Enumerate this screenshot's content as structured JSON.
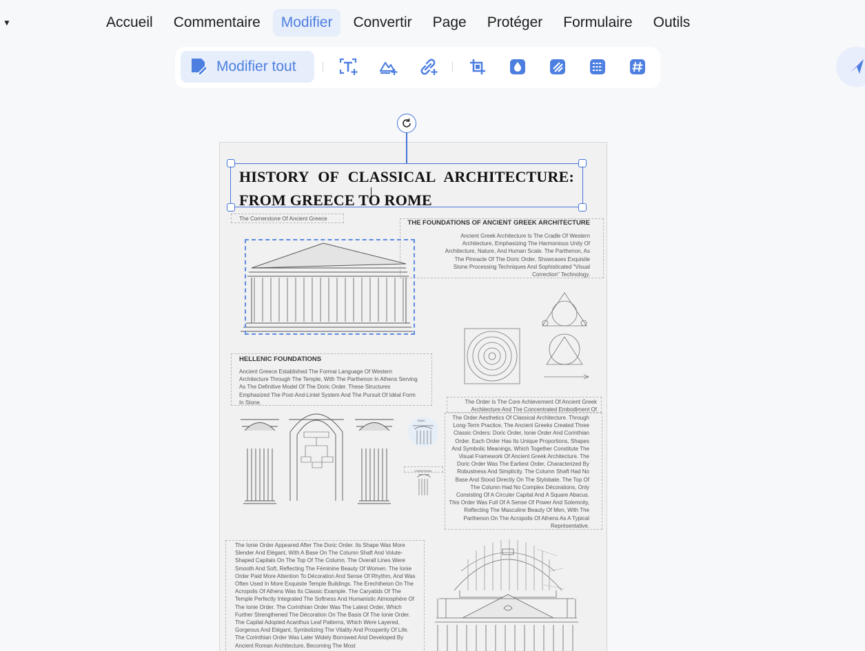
{
  "menu": {
    "items": [
      {
        "label": "Accueil"
      },
      {
        "label": "Commentaire"
      },
      {
        "label": "Modifier"
      },
      {
        "label": "Convertir"
      },
      {
        "label": "Page"
      },
      {
        "label": "Protéger"
      },
      {
        "label": "Formulaire"
      },
      {
        "label": "Outils"
      }
    ],
    "active_index": 2
  },
  "toolbar": {
    "edit_all_label": "Modifier tout",
    "tools": [
      "add-text-icon",
      "add-image-icon",
      "add-link-icon",
      "crop-icon",
      "watermark-icon",
      "background-icon",
      "header-footer-icon",
      "bates-number-icon"
    ]
  },
  "colors": {
    "accent": "#4d7fe0",
    "selection": "#4472d8",
    "active_bg": "#e6edfb"
  },
  "document": {
    "title": "HISTORY OF CLASSICAL ARCHITECTURE: FROM GREECE TO ROME",
    "caption": "The Cornerstone Of Ancient Greece",
    "foundations": {
      "heading": "THE FOUNDATIONS OF ANCIENT GREEK ARCHITECTURE",
      "body": "Ancient Greek Architecture Is The Cradle Of Western Architecture, Emphasizing The Harmonious Unity Of Architecture, Nature, And Human Scale. The Parthenon, As The Pinnacle Of The Doric Order, Showcases Exquisite Stone Processing Techniques And Sophisticated \"Visual Correction\" Technology."
    },
    "hellenic": {
      "heading": "HELLENIC FOUNDATIONS",
      "body": "Ancient Greece Established The Formai Language Of Western Architecture Through The Temple, With The Parthenon In Athens Serving As The Definitive Model Of The Doric Order. These Structures Emphasized The Post-And-Lintel System And The Pursuit Of Idéal Form In Stone."
    },
    "order_intro": "The Order Is The Core Achievement Of Ancient Greek Architecture And The Concentrated Embodiment Of",
    "order_body": "The Order Aesthetics Of Classical Architecture. Through Long-Term Practice, The Ancient Greeks Created Three Classic Orders: Doric Order, Ionie Order And Corinthian Order. Each Order Has Its Unique Proportions, Shapes And Symbolic Meanings, Which Together Constitute The Visual Framework Of Ancient Greek Architecture. The Doric Order Was The Earliest Order, Characterized By Robustness And Simplicity. The Column Shaft Had No Base And Stood Directly On The Stylobate. The Top Of The Column Had No Complex Décorations, Only Consisting Of A Circuler Capital And A Square Abacus. This Order Was Full Of A Sense Of Power And Solemnity, Reflecting The Masculine Beauty Of Men, With The Parthenon On The Acropolis Of Athens As A Typical Représentative.",
    "ionic_body": "The Ionie Order Appeared After The Doric Order. Its Shape Was More Slender And Elégant, With A Base On The Column Shaft And Volute-Shaped Capitals On The Top Of The Column. The Overall Lines Were Smooth And Soft, Reflecting The Féminine Beauty Of Women. The Ionie Order Paid More Attention To Décoration And Sense Of Rhythm, And Was Often Used In More Exquisite Temple Buildings. The Erechtheion On The Acropolis Of Athens Was Its Classic Example. The Caryatids Of The Temple Perfectly Integrated The Softness And Humanistic Atmosphère Of The Ionie Order. The Corinthian Order Was The Latest Order, Which Further Strengthened The Décoration On The Basis Of The Ionie Order. The Capital Adopted Acanthus Leaf Patterns, Which Were Layered, Gorgeous And Elégant, Symbolizing The Vitality And Prosperity Of Life. The Corinthian Order Was Later Widely Borrowed And Developed By Ancient Roman Architecture, Becoming The Most",
    "labels": {
      "ionic": "IONIC",
      "corinthian": "CORINTHIAN"
    }
  }
}
